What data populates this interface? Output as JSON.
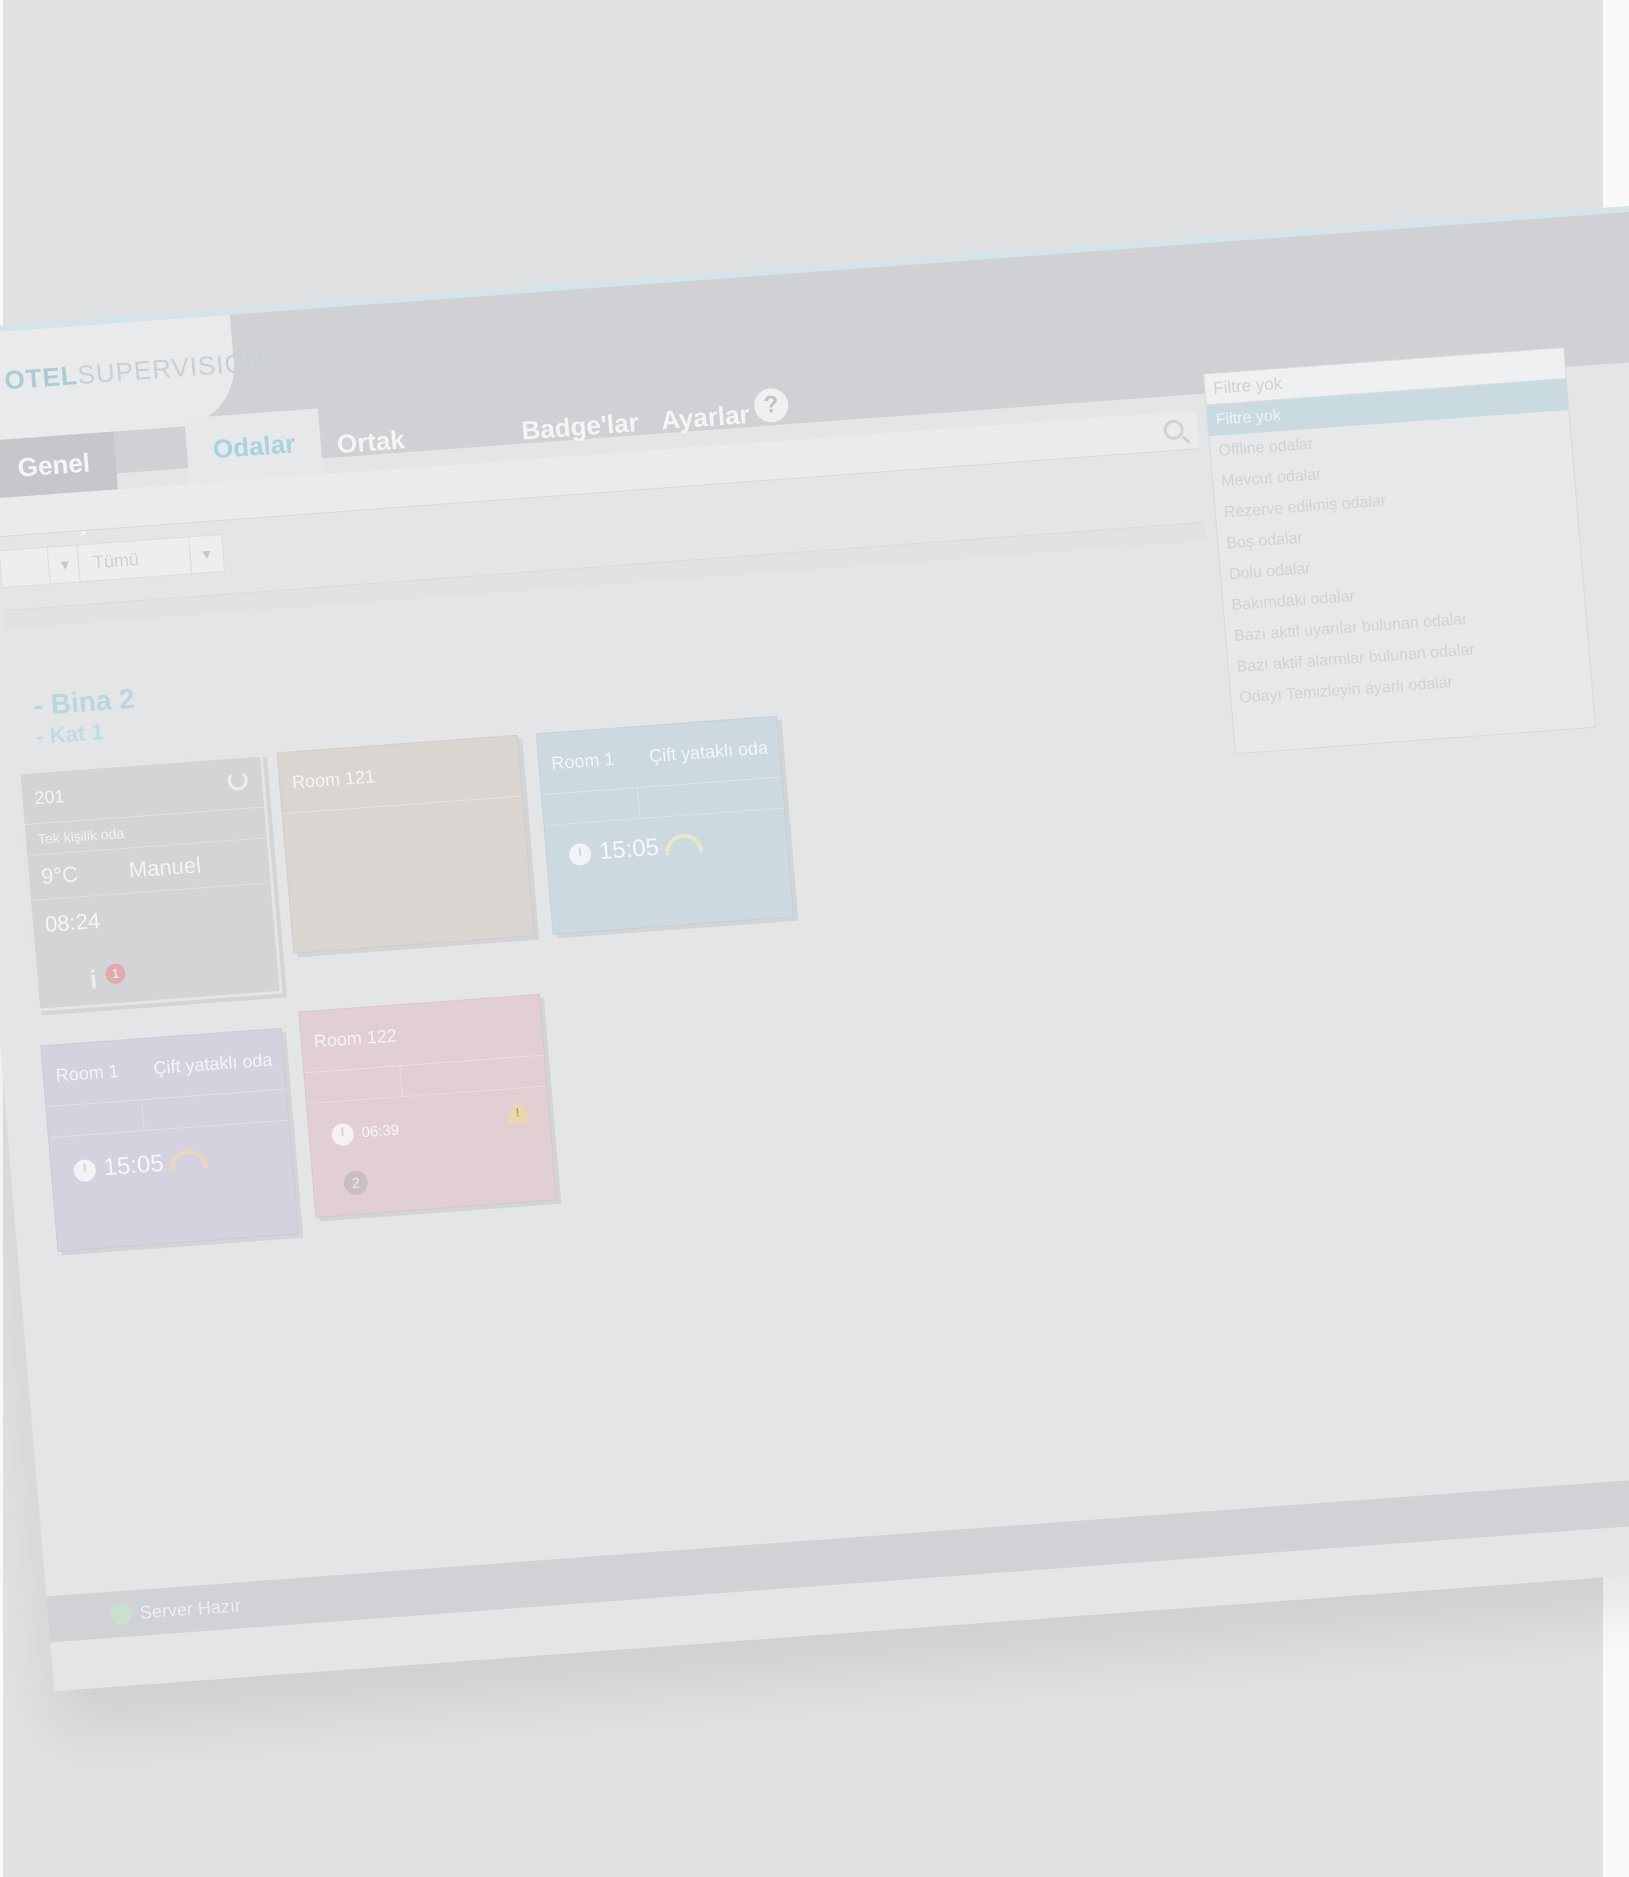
{
  "app": {
    "logo_part1": "OTEL",
    "logo_part2": "SUPERVISION"
  },
  "tabs": [
    {
      "label": "Genel bakış"
    },
    {
      "label": "Odalar"
    },
    {
      "label": "Ortak alanlar"
    },
    {
      "label": "Badge'lar"
    },
    {
      "label": "Ayarlar"
    }
  ],
  "help_label": "?",
  "filters": {
    "first_value": "",
    "second_value": "Tümü"
  },
  "building": {
    "title": "- Bina 2",
    "floor": "- Kat 1"
  },
  "rooms": [
    {
      "name": "201",
      "type": "Tek kişilik oda",
      "temp": "9°C",
      "mode": "Manuel",
      "time": "08:24",
      "alerts": "1"
    },
    {
      "name": "Room 121"
    },
    {
      "name": "Room 1",
      "type": "Çift yataklı oda",
      "time": "15:05"
    },
    {
      "name": "Room 1",
      "type": "Çift yataklı oda",
      "time": "15:05"
    },
    {
      "name": "Room 122",
      "time": "06:39",
      "alarms": "2"
    }
  ],
  "dropdown": {
    "input_value": "Filtre yok",
    "items": [
      "Filtre yok",
      "Offline odalar",
      "Mevcut odalar",
      "Rezerve edilmiş odalar",
      "Boş odalar",
      "Dolu odalar",
      "Bakımdaki odalar",
      "Bazı aktif uyarılar bulunan odalar",
      "Bazı aktif alarmlar bulunan odalar",
      "Odayı Temizleyin ayarlı odalar"
    ]
  },
  "status": {
    "text": "Server Hazır"
  }
}
